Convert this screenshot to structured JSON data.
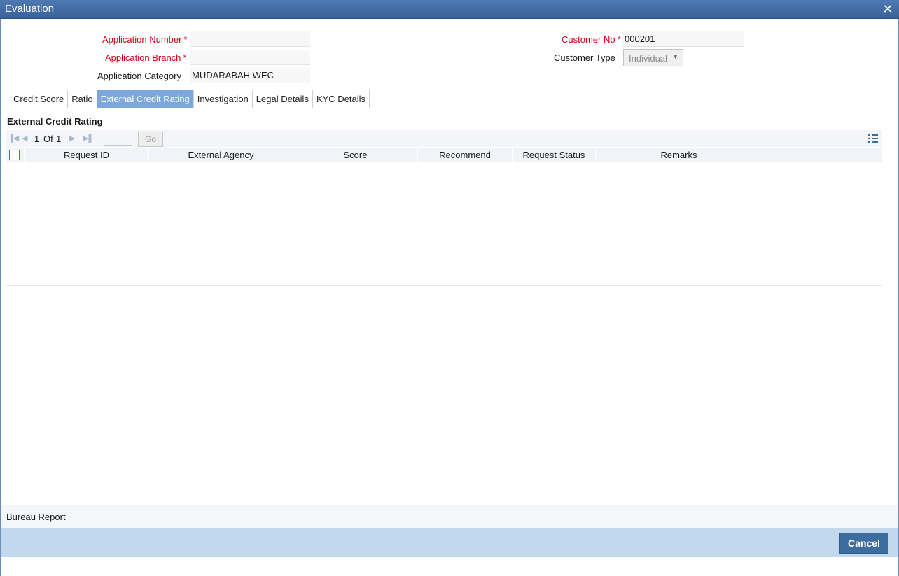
{
  "window": {
    "title": "Evaluation",
    "close_glyph": "✕"
  },
  "form": {
    "application_number": {
      "label": "Application Number",
      "value": "",
      "required": true
    },
    "application_branch": {
      "label": "Application Branch",
      "value": "",
      "required": true
    },
    "application_category": {
      "label": "Application Category",
      "value": "MUDARABAH WEC"
    },
    "customer_no": {
      "label": "Customer No",
      "value": "000201",
      "required": true
    },
    "customer_type": {
      "label": "Customer Type",
      "value": "Individual"
    },
    "required_mark": "*"
  },
  "tabs": [
    {
      "label": "Credit Score",
      "active": false
    },
    {
      "label": "Ratio",
      "active": false
    },
    {
      "label": "External Credit Rating",
      "active": true
    },
    {
      "label": "Investigation",
      "active": false
    },
    {
      "label": "Legal Details",
      "active": false
    },
    {
      "label": "KYC Details",
      "active": false
    }
  ],
  "section": {
    "title": "External Credit Rating",
    "pager": {
      "current": "1",
      "of_label": "Of",
      "total": "1",
      "go_label": "Go"
    },
    "columns": [
      "Request ID",
      "External Agency",
      "Score",
      "Recommend",
      "Request Status",
      "Remarks"
    ],
    "rows": []
  },
  "bureau_report_label": "Bureau Report",
  "footer": {
    "cancel_label": "Cancel"
  },
  "colors": {
    "titlebar": "#3a6299",
    "active_tab": "#7aa7dc",
    "required_label": "#d0021b",
    "footer": "#c2d8ec",
    "cancel_button": "#3d6c9e"
  },
  "icons": {
    "close": "close-icon",
    "first_page": "first-page-icon",
    "prev_page": "prev-page-icon",
    "next_page": "next-page-icon",
    "last_page": "last-page-icon",
    "list_view": "list-view-icon",
    "dropdown": "chevron-down-icon"
  }
}
